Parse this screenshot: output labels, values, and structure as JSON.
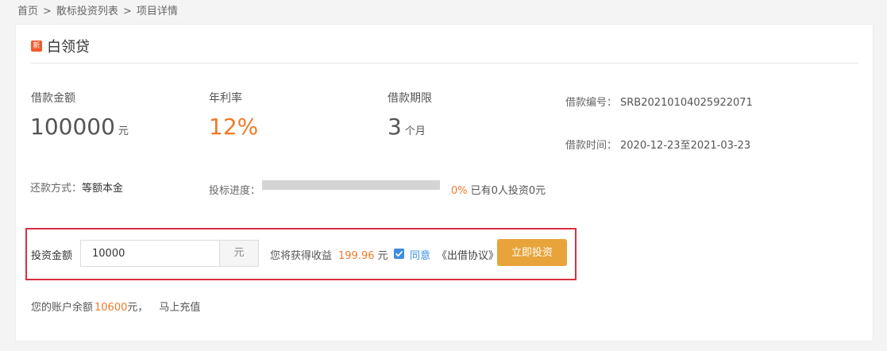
{
  "breadcrumb": {
    "home": "首页",
    "list": "散标投资列表",
    "current": "项目详情",
    "separator": ">"
  },
  "project": {
    "badge": "新",
    "title": "白领贷"
  },
  "stats": {
    "amount_label": "借款金额",
    "amount_value": "100000",
    "amount_unit": "元",
    "rate_label": "年利率",
    "rate_value": "12%",
    "term_label": "借款期限",
    "term_value": "3",
    "term_unit": "个月"
  },
  "meta": {
    "loan_no_label": "借款编号：",
    "loan_no_value": "SRB20210104025922071",
    "loan_time_label": "借款时间：",
    "loan_time_value": "2020-12-23至2021-03-23"
  },
  "repayment": {
    "label": "还款方式：",
    "value": "等额本金"
  },
  "progress": {
    "label": "投标进度：",
    "percent_text": "0%",
    "fraction": 0,
    "summary": "已有0人投资0元"
  },
  "invest": {
    "label": "投资金额",
    "amount_value": "10000",
    "amount_unit": "元",
    "income_label": "您将获得收益",
    "income_value": "199.96",
    "income_unit": "元",
    "agree_checked": true,
    "agree_text": "同意",
    "agreement_doc": "《出借协议》",
    "submit_label": "立即投资"
  },
  "balance": {
    "prefix": "您的账户余额",
    "amount": "10600",
    "suffix": "元，",
    "recharge_label": "马上充值"
  },
  "colors": {
    "accent_orange": "#f07a2a",
    "button_orange": "#e8a43a",
    "link_blue": "#3b8fe0",
    "highlight_red": "#d9303f",
    "badge_red": "#f25a2b"
  }
}
